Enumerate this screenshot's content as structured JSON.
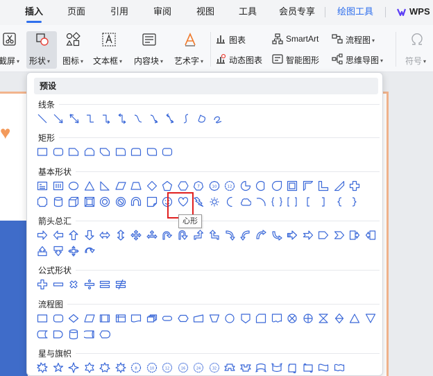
{
  "tabs": [
    {
      "label": "插入",
      "active": true
    },
    {
      "label": "页面"
    },
    {
      "label": "引用"
    },
    {
      "label": "审阅"
    },
    {
      "label": "视图"
    },
    {
      "label": "工具"
    },
    {
      "label": "会员专享"
    },
    {
      "label": "绘图工具"
    },
    {
      "label": "WPS"
    }
  ],
  "ribbon": {
    "screenshot": "截屏",
    "shape": "形状",
    "icon": "图标",
    "textbox": "文本框",
    "content_block": "内容块",
    "art_text": "艺术字",
    "chart": "图表",
    "dynamic_chart": "动态图表",
    "smartart": "SmartArt",
    "smart_shape": "智能图形",
    "flowchart": "流程图",
    "mindmap": "思维导图",
    "symbol": "符号"
  },
  "panel": {
    "preset": "预设",
    "sections": {
      "lines": "线条",
      "rect": "矩形",
      "basic": "基本形状",
      "arrows": "箭头总汇",
      "formula": "公式形状",
      "flow": "流程图",
      "stars": "星与旗帜"
    },
    "tooltip": "心形"
  },
  "colors": {
    "shape_stroke": "#3a68d8",
    "accent": "#2f6fed",
    "highlight": "#e02020"
  }
}
